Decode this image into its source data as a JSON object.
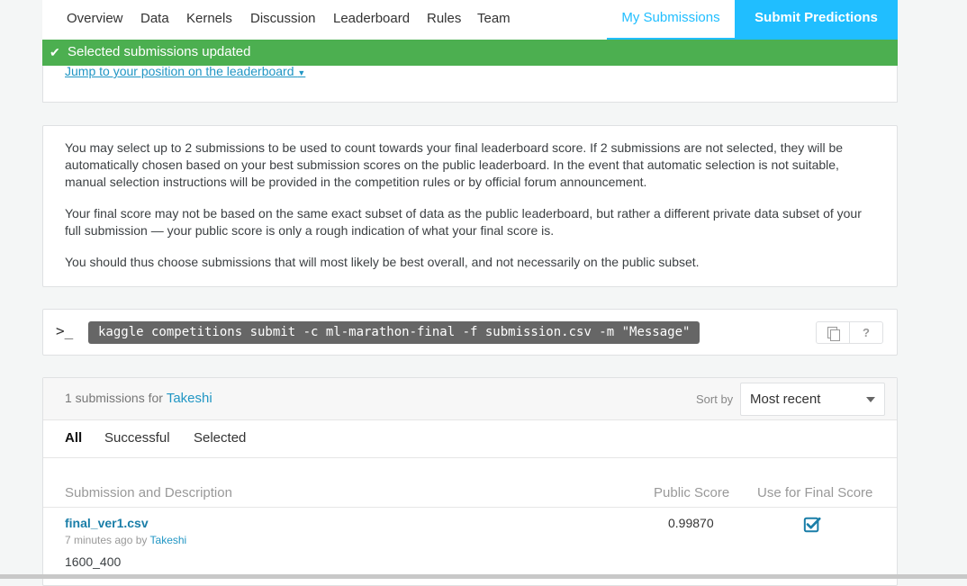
{
  "nav": {
    "items": [
      "Overview",
      "Data",
      "Kernels",
      "Discussion",
      "Leaderboard",
      "Rules",
      "Team"
    ],
    "my_submissions": "My Submissions",
    "submit_predictions": "Submit Predictions"
  },
  "toast": {
    "icon": "check-icon",
    "text": "Selected submissions updated"
  },
  "jump_link": "Jump to your position on the leaderboard",
  "info": {
    "p1": "You may select up to 2 submissions to be used to count towards your final leaderboard score. If 2 submissions are not selected, they will be automatically chosen based on your best submission scores on the public leaderboard. In the event that automatic selection is not suitable, manual selection instructions will be provided in the competition rules or by official forum announcement.",
    "p2": "Your final score may not be based on the same exact subset of data as the public leaderboard, but rather a different private data subset of your full submission — your public score is only a rough indication of what your final score is.",
    "p3": "You should thus choose submissions that will most likely be best overall, and not necessarily on the public subset."
  },
  "cli": {
    "prompt": ">_",
    "command": "kaggle competitions submit -c ml-marathon-final -f submission.csv -m \"Message\"",
    "help": "?"
  },
  "submissions": {
    "count_text": "1 submissions for",
    "user": "Takeshi",
    "sort_label": "Sort by",
    "sort_value": "Most recent",
    "tabs": [
      "All",
      "Successful",
      "Selected"
    ],
    "headers": {
      "submission": "Submission and Description",
      "public_score": "Public Score",
      "use_final": "Use for Final Score"
    },
    "rows": [
      {
        "filename": "final_ver1.csv",
        "time": "7 minutes ago by",
        "by": "Takeshi",
        "description": "1600_400",
        "public_score": "0.99870",
        "selected": true
      }
    ]
  },
  "colors": {
    "accent": "#20beff",
    "success": "#4caf50",
    "link": "#2196c4"
  }
}
